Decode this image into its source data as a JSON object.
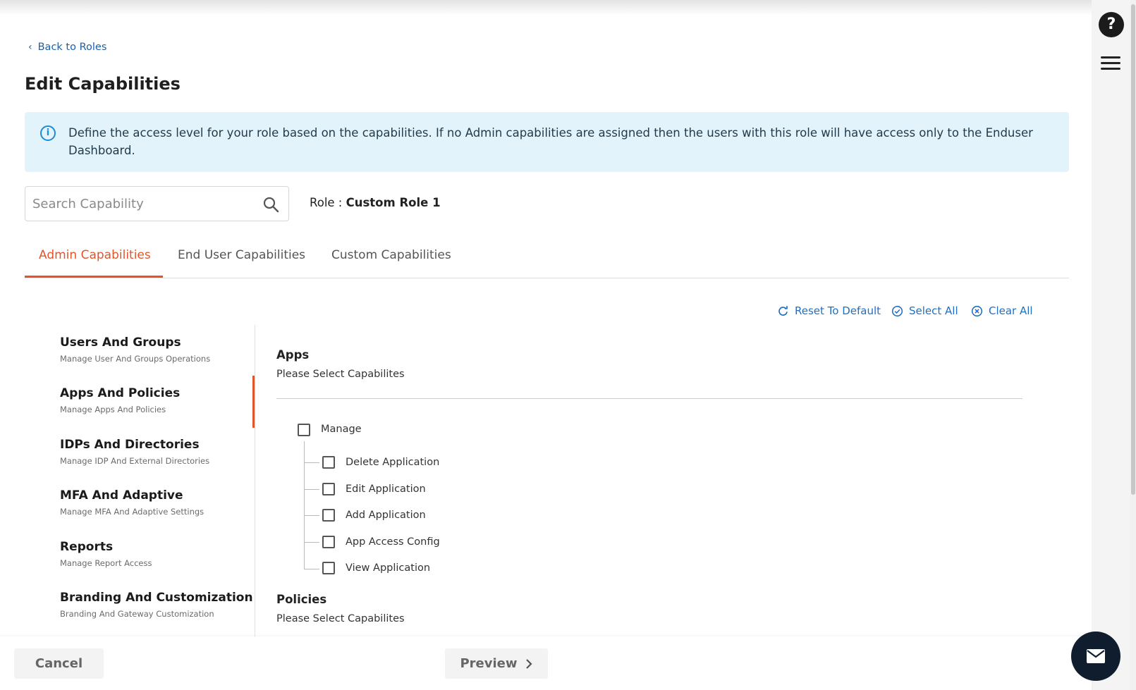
{
  "nav": {
    "back_label": "Back to Roles"
  },
  "page": {
    "title": "Edit Capabilities"
  },
  "info": {
    "text": "Define the access level for your role based on the capabilities. If no Admin capabilities are assigned then the users with this role will have access only to the Enduser Dashboard."
  },
  "search": {
    "placeholder": "Search Capability"
  },
  "role": {
    "label": "Role : ",
    "name": "Custom Role 1"
  },
  "tabs": [
    {
      "label": "Admin Capabilities",
      "active": true
    },
    {
      "label": "End User Capabilities",
      "active": false
    },
    {
      "label": "Custom Capabilities",
      "active": false
    }
  ],
  "actions": {
    "reset": "Reset To Default",
    "select_all": "Select All",
    "clear_all": "Clear All"
  },
  "sidebar": {
    "items": [
      {
        "title": "Users And Groups",
        "subtitle": "Manage User And Groups Operations"
      },
      {
        "title": "Apps And Policies",
        "subtitle": "Manage Apps And Policies"
      },
      {
        "title": "IDPs And Directories",
        "subtitle": "Manage IDP And External Directories"
      },
      {
        "title": "MFA And Adaptive",
        "subtitle": "Manage MFA And Adaptive Settings"
      },
      {
        "title": "Reports",
        "subtitle": "Manage Report Access"
      },
      {
        "title": "Branding And Customization",
        "subtitle": "Branding And Gateway Customization"
      }
    ]
  },
  "sections": [
    {
      "title": "Apps",
      "subtitle": "Please Select Capabilites",
      "parent": "Manage",
      "children": [
        "Delete Application",
        "Edit Application",
        "Add Application",
        "App Access Config",
        "View Application"
      ]
    },
    {
      "title": "Policies",
      "subtitle": "Please Select Capabilites"
    }
  ],
  "footer": {
    "cancel": "Cancel",
    "preview": "Preview"
  },
  "icons": {
    "help": "?",
    "accent_color": "#e0552b",
    "link_color": "#1f6fc3"
  }
}
